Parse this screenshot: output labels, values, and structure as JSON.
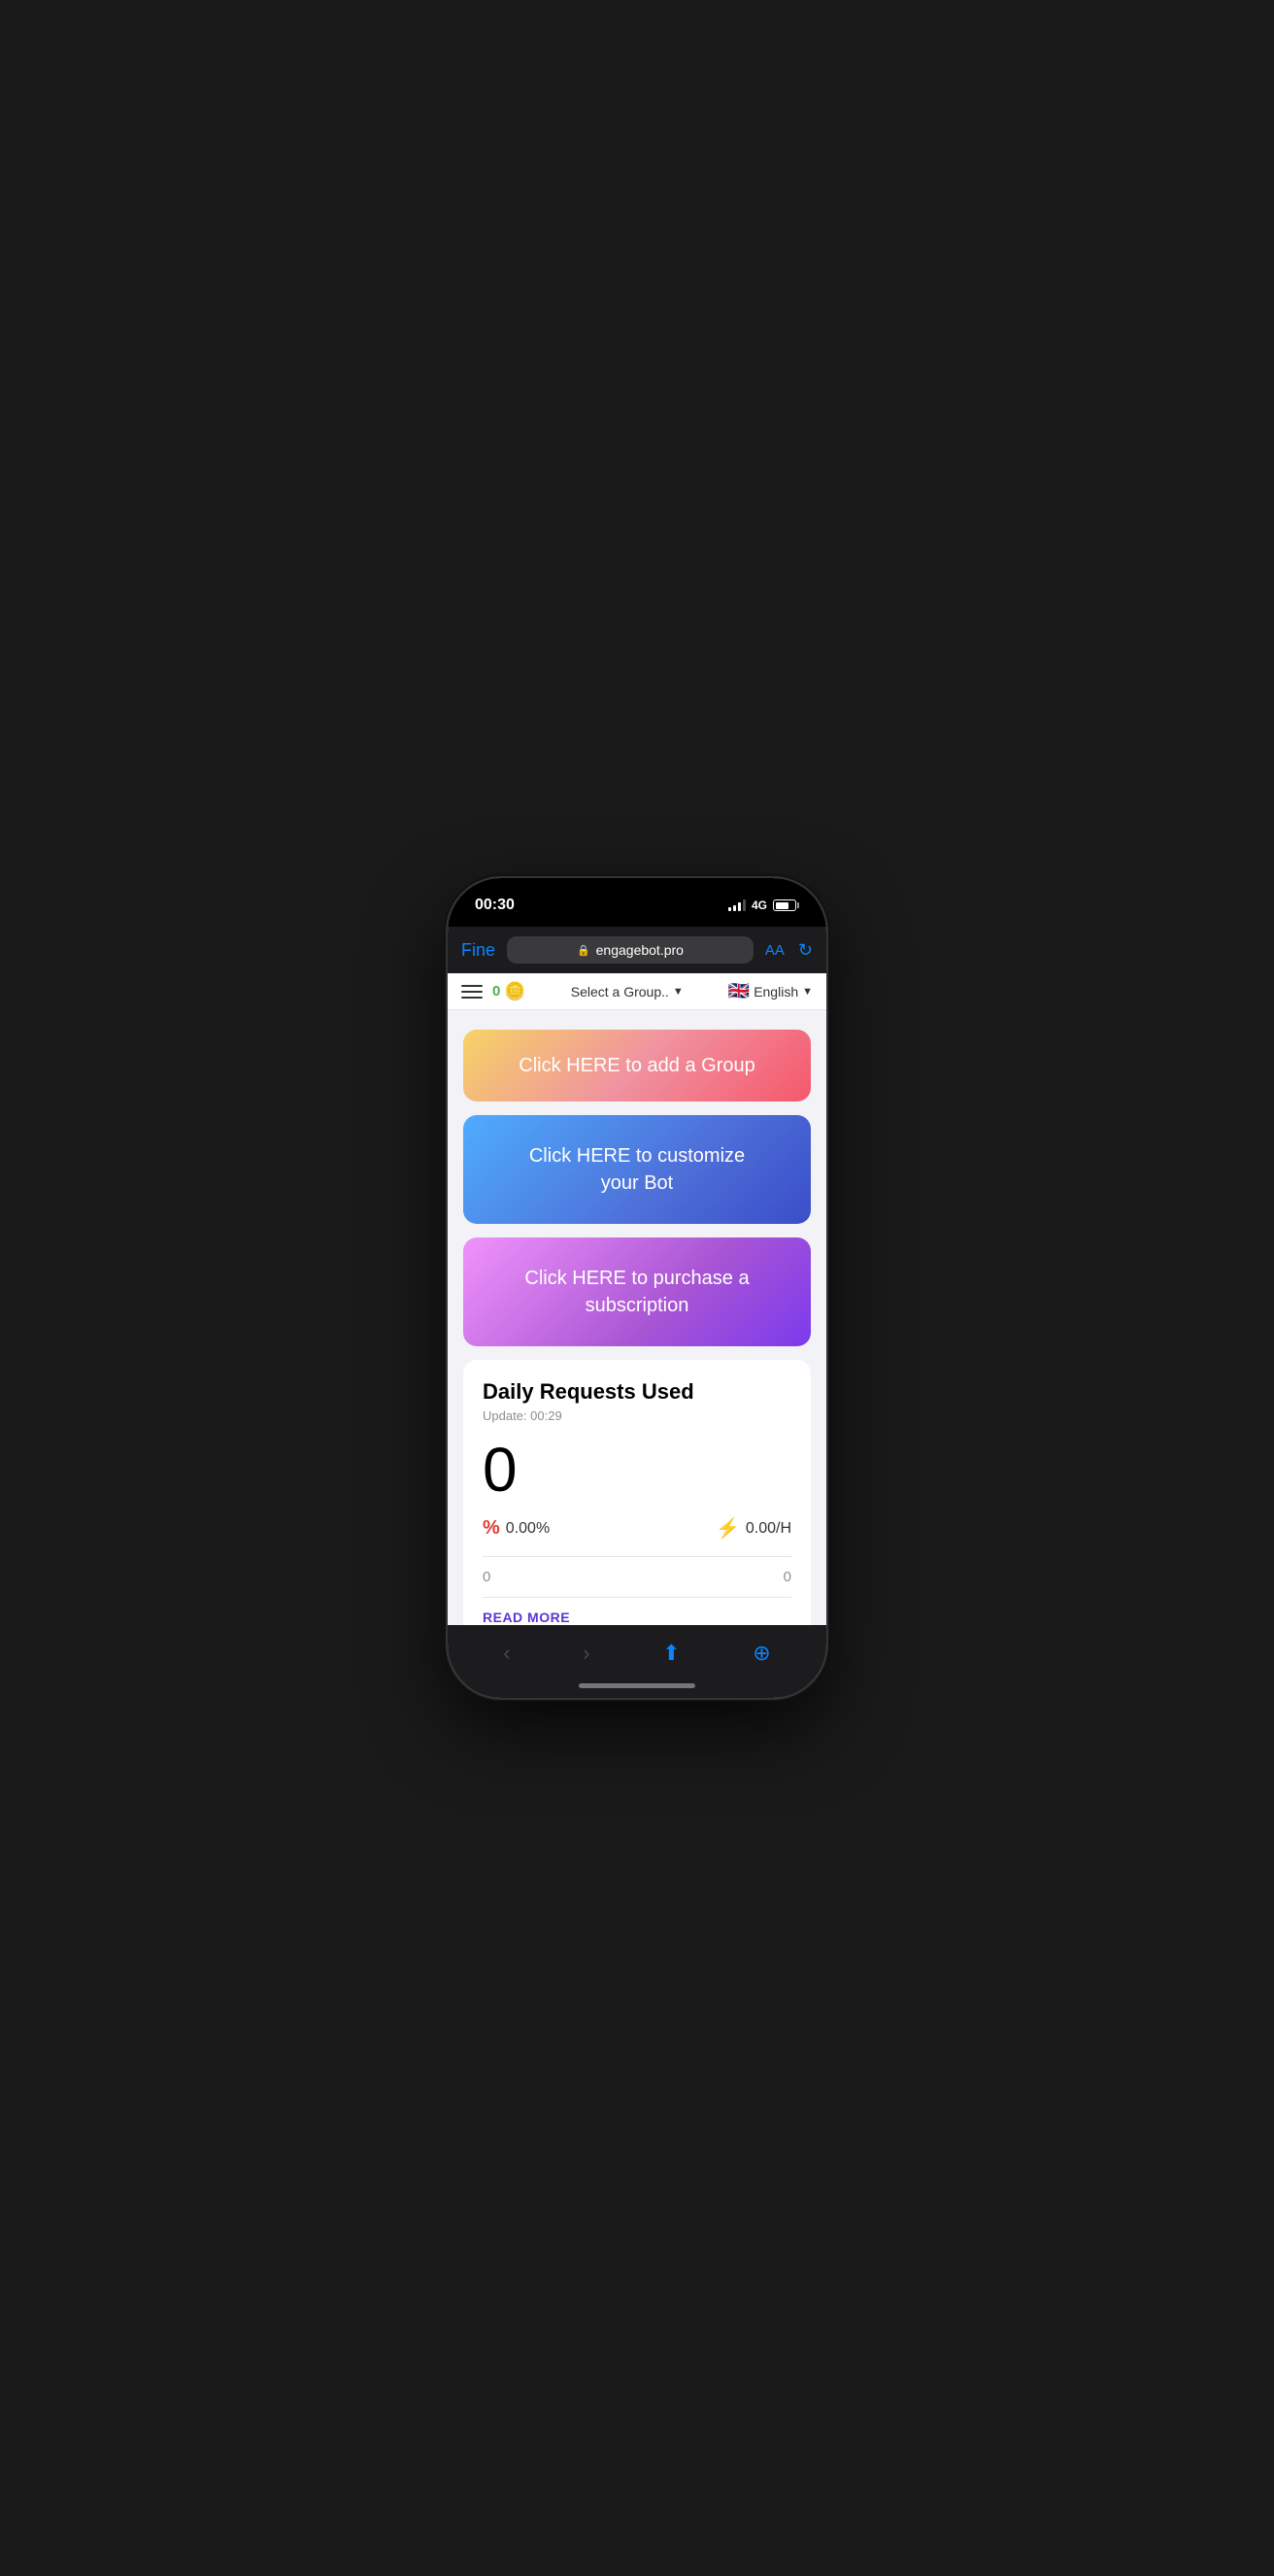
{
  "statusBar": {
    "time": "00:30",
    "network": "4G"
  },
  "browserBar": {
    "backLabel": "Fine",
    "url": "engagebot.pro",
    "aaLabel": "AA"
  },
  "navBar": {
    "coinCount": "0",
    "groupPlaceholder": "Select a Group..",
    "language": "English",
    "flagEmoji": "🇬🇧"
  },
  "buttons": {
    "addGroup": "Click HERE to add a Group",
    "customizeBot": "Click HERE to customize\nyour Bot",
    "purchaseSubscription": "Click HERE to purchase a\nsubscription"
  },
  "statsCard": {
    "title": "Daily Requests Used",
    "updateLabel": "Update: 00:29",
    "count": "0",
    "percentValue": "0.00%",
    "rateValue": "0.00/H",
    "leftNum": "0",
    "rightNum": "0",
    "readMore": "READ MORE"
  }
}
